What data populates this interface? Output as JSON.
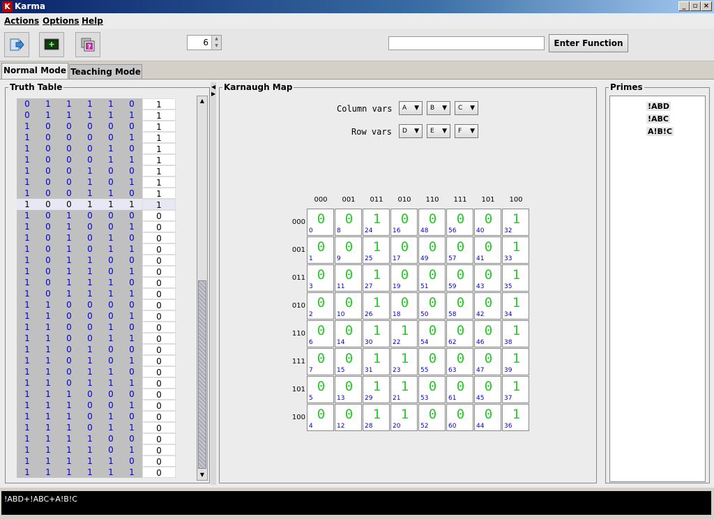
{
  "window": {
    "title": "Karma"
  },
  "menu": [
    "Actions",
    "Options",
    "Help"
  ],
  "toolbar": {
    "variable_count": "6",
    "function_input": "",
    "enter_label": "Enter Function"
  },
  "tabs": [
    "Normal Mode",
    "Teaching Mode"
  ],
  "truth_table": {
    "title": "Truth Table",
    "selected_row_index": 9,
    "rows": [
      {
        "bits": [
          0,
          1,
          1,
          1,
          1,
          0
        ],
        "out": 1
      },
      {
        "bits": [
          0,
          1,
          1,
          1,
          1,
          1
        ],
        "out": 1
      },
      {
        "bits": [
          1,
          0,
          0,
          0,
          0,
          0
        ],
        "out": 1
      },
      {
        "bits": [
          1,
          0,
          0,
          0,
          0,
          1
        ],
        "out": 1
      },
      {
        "bits": [
          1,
          0,
          0,
          0,
          1,
          0
        ],
        "out": 1
      },
      {
        "bits": [
          1,
          0,
          0,
          0,
          1,
          1
        ],
        "out": 1
      },
      {
        "bits": [
          1,
          0,
          0,
          1,
          0,
          0
        ],
        "out": 1
      },
      {
        "bits": [
          1,
          0,
          0,
          1,
          0,
          1
        ],
        "out": 1
      },
      {
        "bits": [
          1,
          0,
          0,
          1,
          1,
          0
        ],
        "out": 1
      },
      {
        "bits": [
          1,
          0,
          0,
          1,
          1,
          1
        ],
        "out": 1
      },
      {
        "bits": [
          1,
          0,
          1,
          0,
          0,
          0
        ],
        "out": 0
      },
      {
        "bits": [
          1,
          0,
          1,
          0,
          0,
          1
        ],
        "out": 0
      },
      {
        "bits": [
          1,
          0,
          1,
          0,
          1,
          0
        ],
        "out": 0
      },
      {
        "bits": [
          1,
          0,
          1,
          0,
          1,
          1
        ],
        "out": 0
      },
      {
        "bits": [
          1,
          0,
          1,
          1,
          0,
          0
        ],
        "out": 0
      },
      {
        "bits": [
          1,
          0,
          1,
          1,
          0,
          1
        ],
        "out": 0
      },
      {
        "bits": [
          1,
          0,
          1,
          1,
          1,
          0
        ],
        "out": 0
      },
      {
        "bits": [
          1,
          0,
          1,
          1,
          1,
          1
        ],
        "out": 0
      },
      {
        "bits": [
          1,
          1,
          0,
          0,
          0,
          0
        ],
        "out": 0
      },
      {
        "bits": [
          1,
          1,
          0,
          0,
          0,
          1
        ],
        "out": 0
      },
      {
        "bits": [
          1,
          1,
          0,
          0,
          1,
          0
        ],
        "out": 0
      },
      {
        "bits": [
          1,
          1,
          0,
          0,
          1,
          1
        ],
        "out": 0
      },
      {
        "bits": [
          1,
          1,
          0,
          1,
          0,
          0
        ],
        "out": 0
      },
      {
        "bits": [
          1,
          1,
          0,
          1,
          0,
          1
        ],
        "out": 0
      },
      {
        "bits": [
          1,
          1,
          0,
          1,
          1,
          0
        ],
        "out": 0
      },
      {
        "bits": [
          1,
          1,
          0,
          1,
          1,
          1
        ],
        "out": 0
      },
      {
        "bits": [
          1,
          1,
          1,
          0,
          0,
          0
        ],
        "out": 0
      },
      {
        "bits": [
          1,
          1,
          1,
          0,
          0,
          1
        ],
        "out": 0
      },
      {
        "bits": [
          1,
          1,
          1,
          0,
          1,
          0
        ],
        "out": 0
      },
      {
        "bits": [
          1,
          1,
          1,
          0,
          1,
          1
        ],
        "out": 0
      },
      {
        "bits": [
          1,
          1,
          1,
          1,
          0,
          0
        ],
        "out": 0
      },
      {
        "bits": [
          1,
          1,
          1,
          1,
          0,
          1
        ],
        "out": 0
      },
      {
        "bits": [
          1,
          1,
          1,
          1,
          1,
          0
        ],
        "out": 0
      },
      {
        "bits": [
          1,
          1,
          1,
          1,
          1,
          1
        ],
        "out": 0
      }
    ]
  },
  "karnaugh": {
    "title": "Karnaugh Map",
    "column_vars_label": "Column vars",
    "row_vars_label": "Row vars",
    "column_vars": [
      "A",
      "B",
      "C"
    ],
    "row_vars": [
      "D",
      "E",
      "F"
    ],
    "column_headers": [
      "000",
      "001",
      "011",
      "010",
      "110",
      "111",
      "101",
      "100"
    ],
    "row_headers": [
      "000",
      "001",
      "011",
      "010",
      "110",
      "111",
      "101",
      "100"
    ],
    "values": [
      [
        0,
        0,
        1,
        0,
        0,
        0,
        0,
        1
      ],
      [
        0,
        0,
        1,
        0,
        0,
        0,
        0,
        1
      ],
      [
        0,
        0,
        1,
        0,
        0,
        0,
        0,
        1
      ],
      [
        0,
        0,
        1,
        0,
        0,
        0,
        0,
        1
      ],
      [
        0,
        0,
        1,
        1,
        0,
        0,
        0,
        1
      ],
      [
        0,
        0,
        1,
        1,
        0,
        0,
        0,
        1
      ],
      [
        0,
        0,
        1,
        1,
        0,
        0,
        0,
        1
      ],
      [
        0,
        0,
        1,
        1,
        0,
        0,
        0,
        1
      ]
    ],
    "indices": [
      [
        0,
        8,
        24,
        16,
        48,
        56,
        40,
        32
      ],
      [
        1,
        9,
        25,
        17,
        49,
        57,
        41,
        33
      ],
      [
        3,
        11,
        27,
        19,
        51,
        59,
        43,
        35
      ],
      [
        2,
        10,
        26,
        18,
        50,
        58,
        42,
        34
      ],
      [
        6,
        14,
        30,
        22,
        54,
        62,
        46,
        38
      ],
      [
        7,
        15,
        31,
        23,
        55,
        63,
        47,
        39
      ],
      [
        5,
        13,
        29,
        21,
        53,
        61,
        45,
        37
      ],
      [
        4,
        12,
        28,
        20,
        52,
        60,
        44,
        36
      ]
    ]
  },
  "primes": {
    "title": "Primes",
    "items": [
      "!ABD",
      "!ABC",
      "A!B!C"
    ]
  },
  "output": {
    "expression": "!ABD+!ABC+A!B!C"
  },
  "colors": {
    "cell_value": "#22cc22",
    "index": "#0000c0",
    "truth_bits": "#0000c0"
  },
  "icons": [
    "export-icon",
    "screen-icon",
    "help-icon"
  ]
}
